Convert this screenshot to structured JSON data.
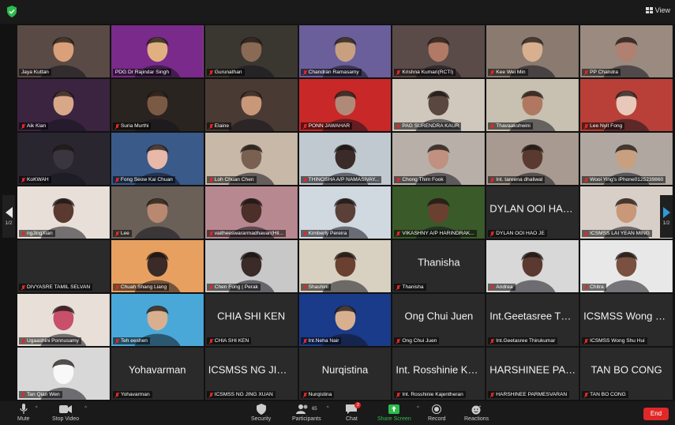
{
  "topbar": {
    "view_label": "View"
  },
  "pagination": {
    "left": "1/2",
    "right": "1/2"
  },
  "tiles": [
    {
      "name": "Jaya Kuttan",
      "video": true,
      "bg": "#5a4a45",
      "fg": "#d9a07a"
    },
    {
      "name": "PDG Dr Rajindar Singh",
      "video": true,
      "bg": "#7a2a8a",
      "fg": "#e0b080"
    },
    {
      "name": "Gurunathan",
      "video": true,
      "bg": "#3a3630",
      "fg": "#8a6a55"
    },
    {
      "name": "Chandran Ramasamy",
      "video": true,
      "bg": "#6a5f9a",
      "fg": "#c8a080"
    },
    {
      "name": "Krishna Kumari(RCTI)",
      "video": true,
      "bg": "#5a4a48",
      "fg": "#b07a65"
    },
    {
      "name": "Kee Wei Min",
      "video": true,
      "bg": "#8a7a70",
      "fg": "#d8b090"
    },
    {
      "name": "PP Chandra",
      "video": true,
      "bg": "#9a8a80",
      "fg": "#b08070"
    },
    {
      "name": "Aik Kian",
      "video": true,
      "bg": "#3a2440",
      "fg": "#d8a888"
    },
    {
      "name": "Suria Murthi",
      "video": true,
      "bg": "#2a2420",
      "fg": "#7a5a45"
    },
    {
      "name": "Elaine",
      "video": true,
      "bg": "#4a3a34",
      "fg": "#c89878"
    },
    {
      "name": "PONN JAWAHAR",
      "video": true,
      "bg": "#c82828",
      "fg": "#b08a78"
    },
    {
      "name": "PAG SURENDRA KAUR",
      "video": true,
      "bg": "#d0c8bc",
      "fg": "#5a4840"
    },
    {
      "name": "Thavaakshwini",
      "video": true,
      "bg": "#c8c0b0",
      "fg": "#b07860"
    },
    {
      "name": "Lee Nyit Fong",
      "video": true,
      "bg": "#b84038",
      "fg": "#e8c8b8"
    },
    {
      "name": "KoKWAH",
      "video": true,
      "bg": "#2a2630",
      "fg": "#3a3640"
    },
    {
      "name": "Fong Seow Kai Chuan",
      "video": true,
      "bg": "#3a5a8a",
      "fg": "#e8b8a8"
    },
    {
      "name": "Loh Chuan Chen",
      "video": true,
      "bg": "#c8b8a8",
      "fg": "#7a6050"
    },
    {
      "name": "THINOSHA A/P NAMASIVAY...",
      "video": true,
      "bg": "#c0c8d0",
      "fg": "#3a2a28"
    },
    {
      "name": "Chong Thim Fook",
      "video": true,
      "bg": "#b8b0a8",
      "fg": "#c09080"
    },
    {
      "name": "Int. tareena dhaliwal",
      "video": true,
      "bg": "#a89a90",
      "fg": "#5a3a30"
    },
    {
      "name": "Wooi Ying's iPhone0125239860",
      "video": true,
      "bg": "#b0a8a0",
      "fg": "#c8a080"
    },
    {
      "name": "ngJingXian",
      "video": true,
      "bg": "#e8e0d8",
      "fg": "#5a3a30"
    },
    {
      "name": "Lee",
      "video": true,
      "bg": "#6a6058",
      "fg": "#b88870"
    },
    {
      "name": "vaitheeswararmadhavan(Hil...",
      "video": true,
      "bg": "#b88890",
      "fg": "#4a3028"
    },
    {
      "name": "Kimberly Pereira",
      "video": true,
      "bg": "#d0d8e0",
      "fg": "#5a4038"
    },
    {
      "name": "VIKASHNY A/P HARINDRAK...",
      "video": true,
      "bg": "#3a5a2a",
      "fg": "#6a4030"
    },
    {
      "name": "DYLAN OOI HAO JE",
      "video": false,
      "big": "DYLAN OOI HAO..."
    },
    {
      "name": "ICSMSS LAI YEAN MING",
      "video": true,
      "bg": "#d8d0c8",
      "fg": "#c89878"
    },
    {
      "name": "DIVYASRE TAMIL SELVAN",
      "video": false,
      "big": ""
    },
    {
      "name": "Chuah Shang Liang",
      "video": true,
      "bg": "#e8a060",
      "fg": "#3a2a28"
    },
    {
      "name": "Chen Fung | Perak",
      "video": true,
      "bg": "#c8c8c8",
      "fg": "#3a2a28"
    },
    {
      "name": "Shashini",
      "video": true,
      "bg": "#d8d0c0",
      "fg": "#6a4030"
    },
    {
      "name": "Thanisha",
      "video": false,
      "big": "Thanisha"
    },
    {
      "name": "Andrea",
      "video": true,
      "bg": "#d8d8d8",
      "fg": "#5a3a30"
    },
    {
      "name": "Chitra",
      "video": true,
      "bg": "#e8e8e8",
      "fg": "#7a5040"
    },
    {
      "name": "Ugaashini Ponnusamy",
      "video": true,
      "bg": "#e8e0d8",
      "fg": "#c8506a"
    },
    {
      "name": "Teh eeshen",
      "video": true,
      "bg": "#4aa8d8",
      "fg": "#d8b090"
    },
    {
      "name": "CHIA SHI KEN",
      "video": false,
      "big": "CHIA SHI KEN"
    },
    {
      "name": "Int.Neha Nair",
      "video": true,
      "bg": "#1a3a8a",
      "fg": "#d8b090"
    },
    {
      "name": "Ong Chui Juen",
      "video": false,
      "big": "Ong Chui Juen"
    },
    {
      "name": "Int.Geetasree Thirukumar",
      "video": false,
      "big": "Int.Geetasree Thir..."
    },
    {
      "name": "ICSMSS Wong Shu Hui",
      "video": false,
      "big": "ICSMSS Wong Sh..."
    },
    {
      "name": "Tan Qian Wen",
      "video": true,
      "bg": "#d8d8d8",
      "fg": "#f8f8f8"
    },
    {
      "name": "Yohavarman",
      "video": false,
      "big": "Yohavarman"
    },
    {
      "name": "ICSMSS NG JING XUAN",
      "video": false,
      "big": "ICSMSS NG JING..."
    },
    {
      "name": "Nurqistina",
      "video": false,
      "big": "Nurqistina"
    },
    {
      "name": "Int. Rosshinie Kajentheran",
      "video": false,
      "big": "Int. Rosshinie Kaje..."
    },
    {
      "name": "HARSHINEE PARMESVARAN",
      "video": false,
      "big": "HARSHINEE PAR..."
    },
    {
      "name": "TAN BO CONG",
      "video": false,
      "big": "TAN BO CONG"
    }
  ],
  "toolbar": {
    "mute": "Mute",
    "stop_video": "Stop Video",
    "security": "Security",
    "participants": "Participants",
    "participants_count": "65",
    "chat": "Chat",
    "chat_badge": "2",
    "share_screen": "Share Screen",
    "record": "Record",
    "reactions": "Reactions",
    "end": "End"
  },
  "colors": {
    "share_green": "#2dbb4d",
    "end_red": "#e02828",
    "active_outline": "#d8f060",
    "accent_blue": "#2f9bd6"
  }
}
